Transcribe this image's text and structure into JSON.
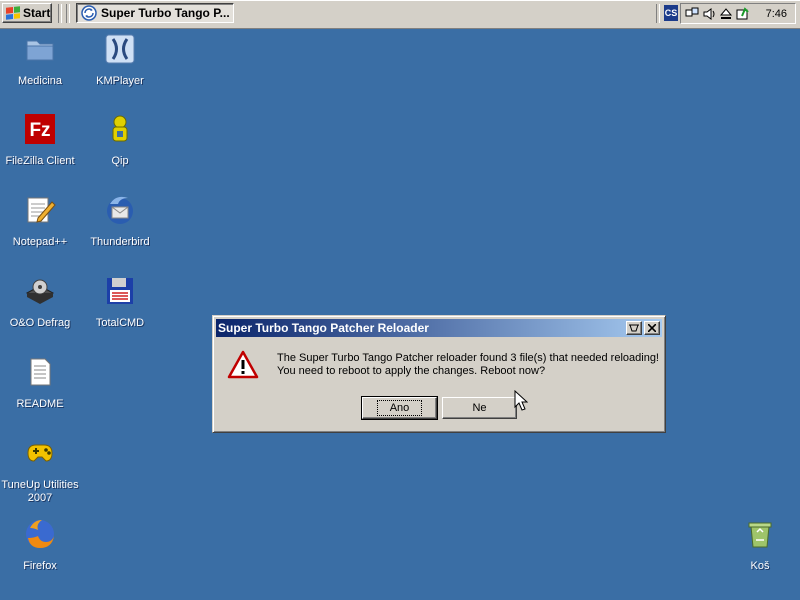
{
  "taskbar": {
    "start_label": "Start",
    "task_label": "Super Turbo Tango P...",
    "language": "CS",
    "clock": "7:46"
  },
  "desktop": {
    "icons": [
      {
        "label": "Medicina",
        "icon": "folder-icon"
      },
      {
        "label": "KMPlayer",
        "icon": "kmplayer-icon"
      },
      {
        "label": "FileZilla Client",
        "icon": "filezilla-icon"
      },
      {
        "label": "Qip",
        "icon": "qip-icon"
      },
      {
        "label": "Notepad++",
        "icon": "notepad-icon"
      },
      {
        "label": "Thunderbird",
        "icon": "thunderbird-icon"
      },
      {
        "label": "O&O Defrag",
        "icon": "defrag-icon"
      },
      {
        "label": "TotalCMD",
        "icon": "floppy-icon"
      },
      {
        "label": "README",
        "icon": "text-file-icon"
      },
      {
        "label": "TuneUp Utilities 2007",
        "icon": "tuneup-icon"
      },
      {
        "label": "Firefox",
        "icon": "firefox-icon"
      },
      {
        "label": "Koš",
        "icon": "recycle-bin-icon"
      }
    ]
  },
  "dialog": {
    "title": "Super Turbo Tango Patcher Reloader",
    "line1": "The Super Turbo Tango Patcher reloader found 3 file(s) that needed reloading!",
    "line2": "You need to reboot to apply the changes. Reboot now?",
    "yes_label": "Ano",
    "no_label": "Ne"
  },
  "colors": {
    "desktop": "#3a6ea5",
    "titlebar_start": "#0a246a",
    "titlebar_end": "#a6caf0",
    "chrome": "#d4d0c8"
  }
}
